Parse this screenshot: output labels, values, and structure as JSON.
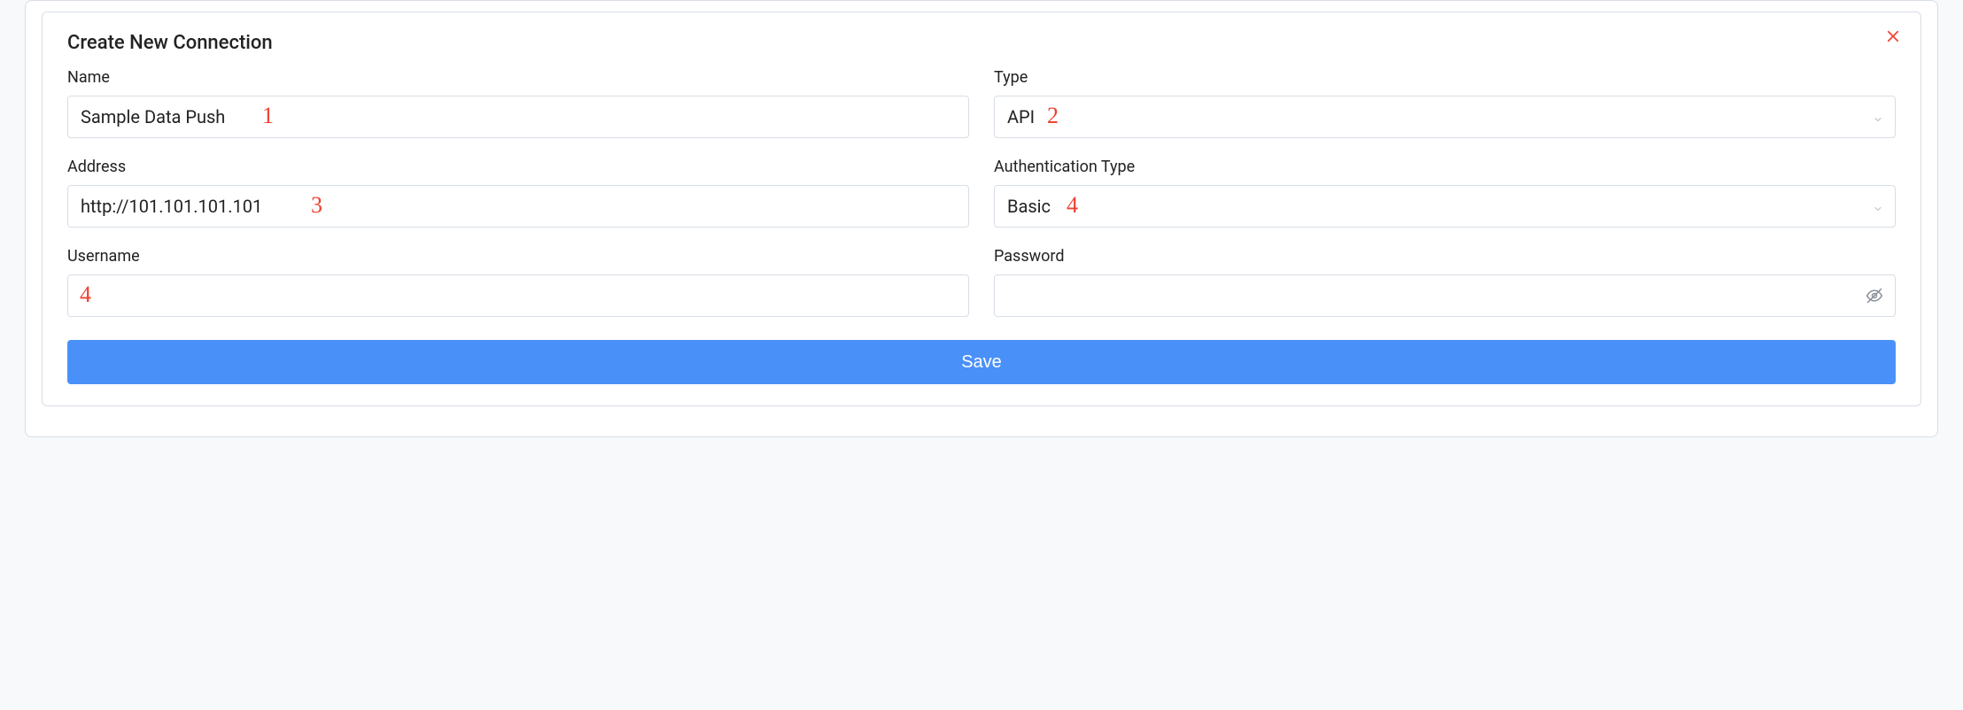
{
  "form": {
    "title": "Create New Connection",
    "fields": {
      "name": {
        "label": "Name",
        "value": "Sample Data Push"
      },
      "type": {
        "label": "Type",
        "value": "API"
      },
      "address": {
        "label": "Address",
        "value": "http://101.101.101.101"
      },
      "auth_type": {
        "label": "Authentication Type",
        "value": "Basic"
      },
      "username": {
        "label": "Username",
        "value": ""
      },
      "password": {
        "label": "Password",
        "value": ""
      }
    },
    "save_label": "Save"
  },
  "annotations": {
    "a1": "1",
    "a2": "2",
    "a3": "3",
    "a4": "4",
    "a5": "4"
  }
}
